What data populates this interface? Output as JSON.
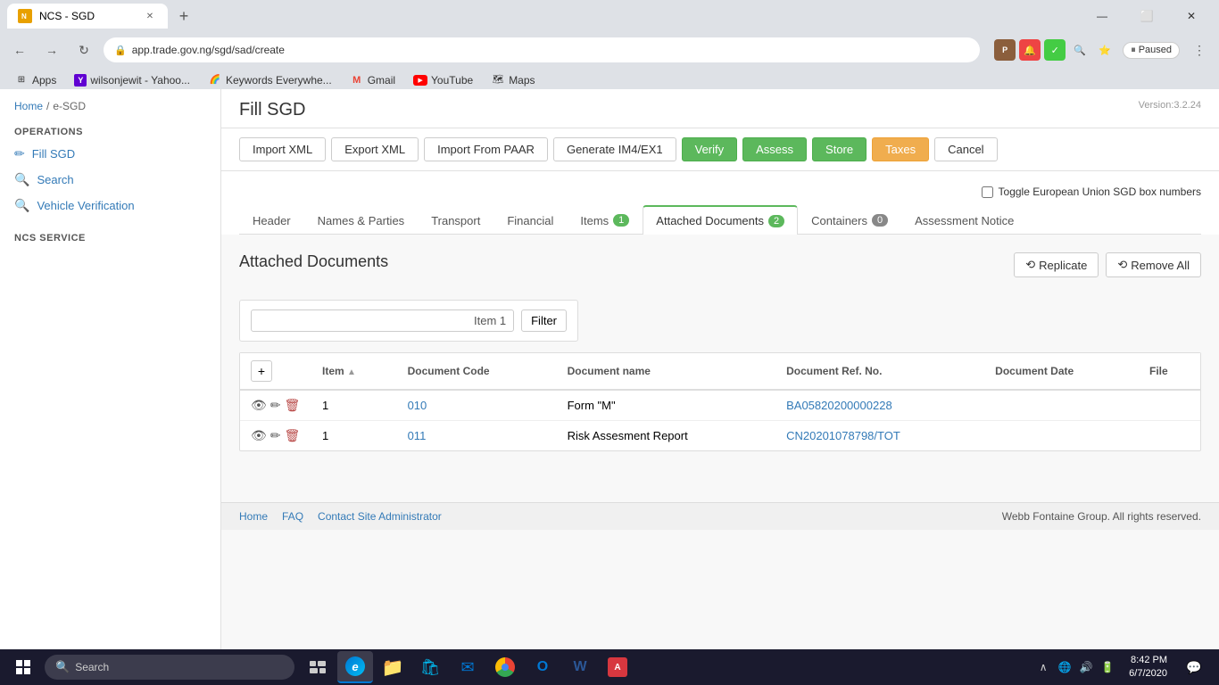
{
  "browser": {
    "tab_title": "NCS - SGD",
    "url": "app.trade.gov.ng/sgd/sad/create",
    "new_tab_icon": "+",
    "win_minimize": "—",
    "win_maximize": "⬜",
    "win_close": "✕"
  },
  "bookmarks": [
    {
      "id": "apps",
      "label": "Apps",
      "icon": "⊞"
    },
    {
      "id": "yahoo",
      "label": "wilsonjewit - Yahoo...",
      "icon": "Y"
    },
    {
      "id": "keywords",
      "label": "Keywords Everywhe...",
      "icon": "🔑"
    },
    {
      "id": "gmail",
      "label": "Gmail",
      "icon": "M"
    },
    {
      "id": "youtube",
      "label": "YouTube",
      "icon": "▶"
    },
    {
      "id": "maps",
      "label": "Maps",
      "icon": "📍"
    }
  ],
  "sidebar": {
    "breadcrumb_home": "Home",
    "breadcrumb_sep": "/",
    "breadcrumb_current": "e-SGD",
    "operations_header": "OPERATIONS",
    "nav_items": [
      {
        "id": "fill-sgd",
        "label": "Fill SGD",
        "icon": "✏"
      },
      {
        "id": "search",
        "label": "Search",
        "icon": "🔍"
      },
      {
        "id": "vehicle",
        "label": "Vehicle Verification",
        "icon": "🔍"
      }
    ],
    "ncs_header": "NCS SERVICE"
  },
  "header": {
    "title": "Fill SGD",
    "version": "Version:3.2.24"
  },
  "toolbar": {
    "import_xml": "Import XML",
    "export_xml": "Export XML",
    "import_paar": "Import From PAAR",
    "generate": "Generate IM4/EX1",
    "verify": "Verify",
    "assess": "Assess",
    "store": "Store",
    "taxes": "Taxes",
    "cancel": "Cancel"
  },
  "eu_toggle_label": "Toggle European Union SGD box numbers",
  "tabs": [
    {
      "id": "header",
      "label": "Header",
      "badge": null
    },
    {
      "id": "names-parties",
      "label": "Names & Parties",
      "badge": null
    },
    {
      "id": "transport",
      "label": "Transport",
      "badge": null
    },
    {
      "id": "financial",
      "label": "Financial",
      "badge": null
    },
    {
      "id": "items",
      "label": "Items",
      "badge": "1"
    },
    {
      "id": "attached-documents",
      "label": "Attached Documents",
      "badge": "2",
      "active": true
    },
    {
      "id": "containers",
      "label": "Containers",
      "badge": "0"
    },
    {
      "id": "assessment-notice",
      "label": "Assessment Notice",
      "badge": null
    }
  ],
  "section_title": "Attached Documents",
  "actions": {
    "replicate": "Replicate",
    "remove_all": "Remove All"
  },
  "filter": {
    "value": "Item 1",
    "button": "Filter"
  },
  "table": {
    "add_button": "+",
    "columns": [
      {
        "id": "actions",
        "label": ""
      },
      {
        "id": "item",
        "label": "Item",
        "sort": "▲"
      },
      {
        "id": "doc-code",
        "label": "Document Code"
      },
      {
        "id": "doc-name",
        "label": "Document name"
      },
      {
        "id": "doc-ref",
        "label": "Document Ref. No."
      },
      {
        "id": "doc-date",
        "label": "Document Date"
      },
      {
        "id": "file",
        "label": "File"
      }
    ],
    "rows": [
      {
        "item": "1",
        "doc_code": "010",
        "doc_name": "Form \"M\"",
        "doc_ref": "BA05820200000228",
        "doc_date": "",
        "file": ""
      },
      {
        "item": "1",
        "doc_code": "011",
        "doc_name": "Risk Assesment Report",
        "doc_ref": "CN20201078798/TOT",
        "doc_date": "",
        "file": ""
      }
    ]
  },
  "footer": {
    "home": "Home",
    "faq": "FAQ",
    "contact": "Contact Site Administrator",
    "copyright": "Webb Fontaine Group. All rights reserved."
  },
  "taskbar": {
    "search_placeholder": "Search",
    "time": "8:42 PM",
    "date": "6/7/2020"
  }
}
